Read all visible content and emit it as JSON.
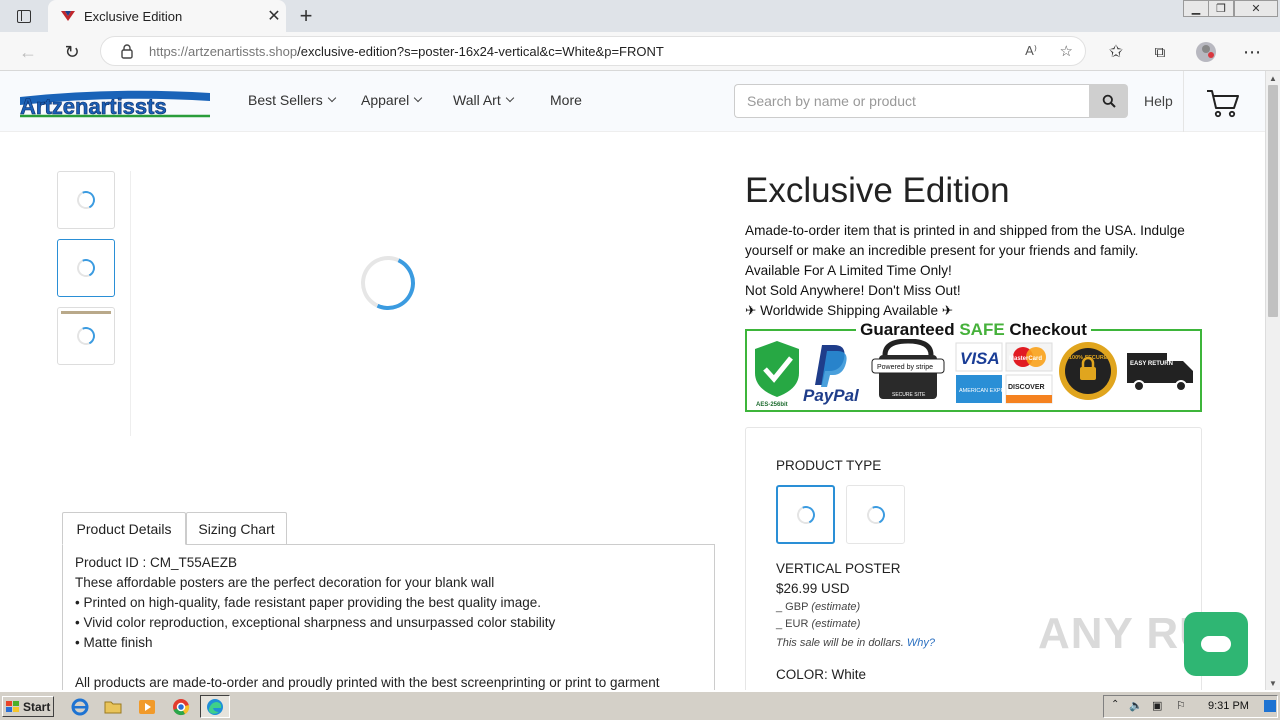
{
  "browser": {
    "tab_title": "Exclusive Edition",
    "url_host": "https://artzenartissts.shop",
    "url_path": "/exclusive-edition?s=poster-16x24-vertical&c=White&p=FRONT",
    "window_controls": [
      "minimize",
      "restore",
      "close"
    ]
  },
  "site": {
    "logo_text": "Artzenartissts",
    "nav": [
      {
        "label": "Best Sellers",
        "dropdown": true
      },
      {
        "label": "Apparel",
        "dropdown": true
      },
      {
        "label": "Wall Art",
        "dropdown": true
      },
      {
        "label": "More",
        "dropdown": false
      }
    ],
    "search_placeholder": "Search by name or product",
    "help_label": "Help"
  },
  "product": {
    "title": "Exclusive Edition",
    "description_lines": [
      "Amade-to-order item that is printed in and shipped from the USA. Indulge yourself or make an incredible present for your friends and family.",
      "Available For A Limited Time Only!",
      "Not Sold Anywhere! Don't Miss Out!",
      "✈ Worldwide Shipping Available ✈"
    ],
    "badge": {
      "title_prefix": "Guaranteed ",
      "title_highlight": "SAFE",
      "title_suffix": " Checkout",
      "aes_label": "AES-256bit",
      "paypal_label": "PayPal",
      "stripe_label": "Powered by stripe",
      "stripe_sub": "SECURE SITE",
      "visa_label": "VISA",
      "mastercard_label": "MasterCard",
      "amex_label": "AMERICAN EXPRESS",
      "discover_label": "DISCOVER",
      "secure_seal_label": "100% SECURE",
      "easy_return_label": "EASY RETURN"
    },
    "tabs": [
      "Product Details",
      "Sizing Chart"
    ],
    "details": {
      "product_id": "Product ID : CM_T55AEZB",
      "intro": "These affordable posters are the perfect decoration for your blank wall",
      "bullets": [
        "• Printed on high-quality, fade resistant paper providing the best quality image.",
        "• Vivid color reproduction, exceptional sharpness and unsurpassed color stability",
        "• Matte finish"
      ],
      "footer": "All products are made-to-order and proudly printed with the best screenprinting or print to garment"
    },
    "options": {
      "product_type_label": "PRODUCT TYPE",
      "selected_type": "VERTICAL POSTER",
      "price": "$26.99 USD",
      "gbp_label": "_ GBP",
      "eur_label": "_ EUR",
      "estimate_label": "(estimate)",
      "sale_note": "This sale will be in dollars.",
      "why_link": "Why?",
      "color_label": "COLOR: White"
    }
  },
  "overlay": {
    "watermark": "ANY RUN"
  },
  "taskbar": {
    "start_label": "Start",
    "clock": "9:31 PM"
  },
  "colors": {
    "accent_blue": "#2a8fd6",
    "safe_green": "#3db53a",
    "chat_green": "#2fb673"
  }
}
